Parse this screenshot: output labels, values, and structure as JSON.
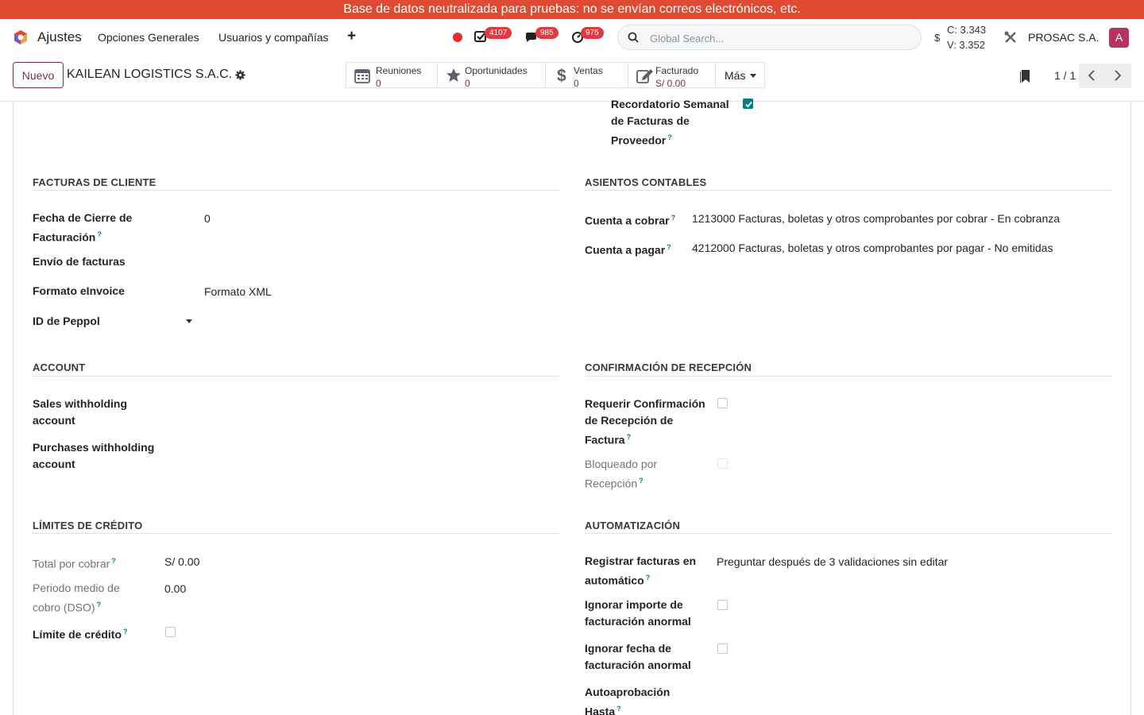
{
  "banner": {
    "text": "Base de datos neutralizada para pruebas: no se envían correos electrónicos, etc."
  },
  "navbar": {
    "app_name": "Ajustes",
    "menu": [
      "Opciones Generales",
      "Usuarios y compañías"
    ],
    "badges": {
      "activities": "4107",
      "messages": "985",
      "timesheets": "975"
    },
    "search_placeholder": "Global Search...",
    "rate_symbol": "$",
    "rate_c": "C: 3.343",
    "rate_v": "V: 3.352",
    "company": "PROSAC S.A.",
    "avatar_letter": "A",
    "colors": {
      "banner": "#e04a32",
      "badge": "#e03a3e",
      "avatar": "#b5335e",
      "accent": "#7b2e4e",
      "check": "#017e84"
    }
  },
  "control": {
    "new_button": "Nuevo",
    "record_title": "KAILEAN LOGISTICS S.A.C.",
    "stats": [
      {
        "label": "Reuniones",
        "value": "0",
        "icon": "calendar-icon"
      },
      {
        "label": "Oportunidades",
        "value": "0",
        "icon": "star-icon"
      },
      {
        "label": "Ventas",
        "value": "0",
        "icon": "dollar-icon"
      },
      {
        "label": "Facturado",
        "value": "S/ 0.00",
        "icon": "edit-invoice-icon"
      }
    ],
    "more": "Más",
    "pager": "1 / 1"
  },
  "form": {
    "reminder": {
      "label_lines": [
        "Recordatorio Semanal",
        "de Facturas de",
        "Proveedor"
      ],
      "help": "?",
      "checked": true
    },
    "customer_invoices": {
      "title": "FACTURAS DE CLIENTE",
      "invoice_close_label_1": "Fecha de Cierre de",
      "invoice_close_label_2": "Facturación",
      "invoice_close_value": "0",
      "sending_label": "Envío de facturas",
      "einvoice_label": "Formato eInvoice",
      "einvoice_value": "Formato XML",
      "peppol_label": "ID de Peppol"
    },
    "accounting_entries": {
      "title": "ASIENTOS CONTABLES",
      "receivable_label": "Cuenta a cobrar",
      "receivable_value": "1213000 Facturas, boletas y otros comprobantes por cobrar - En cobranza",
      "payable_label": "Cuenta a pagar",
      "payable_value": "4212000 Facturas, boletas y otros comprobantes por pagar - No emitidas"
    },
    "account": {
      "title": "ACCOUNT",
      "sales_label_1": "Sales withholding",
      "sales_label_2": "account",
      "purchases_label_1": "Purchases withholding",
      "purchases_label_2": "account"
    },
    "reception": {
      "title": "CONFIRMACIÓN DE RECEPCIÓN",
      "require_label_1": "Requerir Confirmación",
      "require_label_2": "de Recepción de",
      "require_label_3": "Factura",
      "require_checked": false,
      "blocked_label_1": "Bloqueado por",
      "blocked_label_2": "Recepción",
      "blocked_checked": false
    },
    "credit_limits": {
      "title": "LÍMITES DE CRÉDITO",
      "total_label": "Total por cobrar",
      "total_value": "S/ 0.00",
      "dso_label_1": "Periodo medio de",
      "dso_label_2": "cobro (DSO)",
      "dso_value": "0.00",
      "limit_label": "Límite de crédito",
      "limit_checked": false
    },
    "automation": {
      "title": "AUTOMATIZACIÓN",
      "auto_label_1": "Registrar facturas en",
      "auto_label_2": "automático",
      "auto_value": "Preguntar después de 3 validaciones sin editar",
      "ignore_amount_1": "Ignorar importe de",
      "ignore_amount_2": "facturación anormal",
      "ignore_date_1": "Ignorar fecha de",
      "ignore_date_2": "facturación anormal",
      "auto_approval_1": "Autoaprobación",
      "auto_approval_2": "Hasta"
    },
    "help_mark": "?"
  }
}
